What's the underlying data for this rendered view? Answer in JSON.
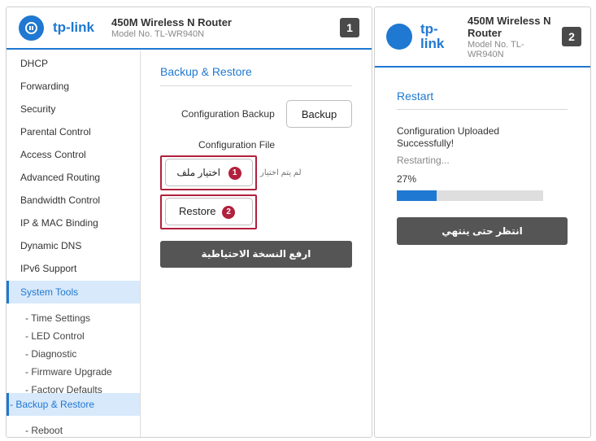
{
  "colors": {
    "accent": "#1f78d1",
    "highlight": "#b1203c",
    "dark_button": "#555555"
  },
  "panel1": {
    "badge": "1",
    "brand": "tp-link",
    "model_title": "450M Wireless N Router",
    "model_no": "Model No. TL-WR940N",
    "sidebar": {
      "items": [
        "DHCP",
        "Forwarding",
        "Security",
        "Parental Control",
        "Access Control",
        "Advanced Routing",
        "Bandwidth Control",
        "IP & MAC Binding",
        "Dynamic DNS",
        "IPv6 Support",
        "System Tools"
      ],
      "sub_items": [
        "- Time Settings",
        "- LED Control",
        "- Diagnostic",
        "- Firmware Upgrade",
        "- Factory Defaults",
        "- Backup & Restore",
        "- Reboot"
      ]
    },
    "content": {
      "title": "Backup & Restore",
      "config_backup_label": "Configuration Backup",
      "backup_button": "Backup",
      "config_file_label": "Configuration File",
      "choose_file_button": "اختيار ملف",
      "no_file_text": "لم يتم اختيار",
      "step1": "1",
      "restore_button": "Restore",
      "step2": "2",
      "upload_backup_button": "ارفع النسخة الاحتياطية"
    }
  },
  "panel2": {
    "badge": "2",
    "brand_line1": "tp-",
    "brand_line2": "link",
    "model_title_line1": "450M Wireless N",
    "model_title_line2": "Router",
    "model_no_line1": "Model No. TL-",
    "model_no_line2": "WR940N",
    "content": {
      "title": "Restart",
      "message_line1": "Configuration Uploaded",
      "message_line2": "Successfully!",
      "status": "Restarting...",
      "progress_text": "27%",
      "progress_value": 0.27,
      "wait_button": "انتظر حتى ينتهي"
    }
  }
}
